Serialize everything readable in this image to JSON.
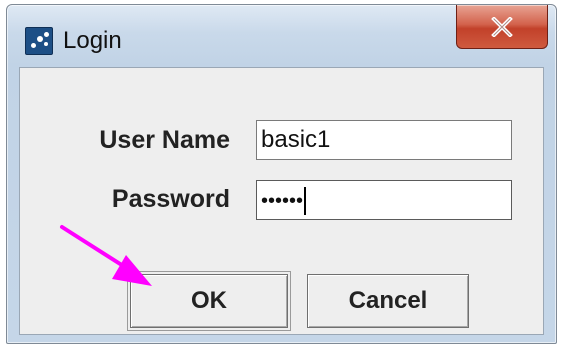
{
  "window": {
    "title": "Login",
    "app_icon": "app-dots-icon",
    "close_icon": "close-icon",
    "close_label": "X"
  },
  "form": {
    "user_name_label": "User Name",
    "user_name_value": "basic1",
    "password_label": "Password",
    "password_value": "••••••"
  },
  "buttons": {
    "ok_label": "OK",
    "cancel_label": "Cancel"
  },
  "annotation": {
    "arrow_color": "#ff00ff",
    "arrow_icon": "pointer-arrow-icon"
  },
  "colors": {
    "close_button": "#c9452f",
    "title_bar": "#c9d9ea",
    "dialog_body": "#eeeeee"
  }
}
